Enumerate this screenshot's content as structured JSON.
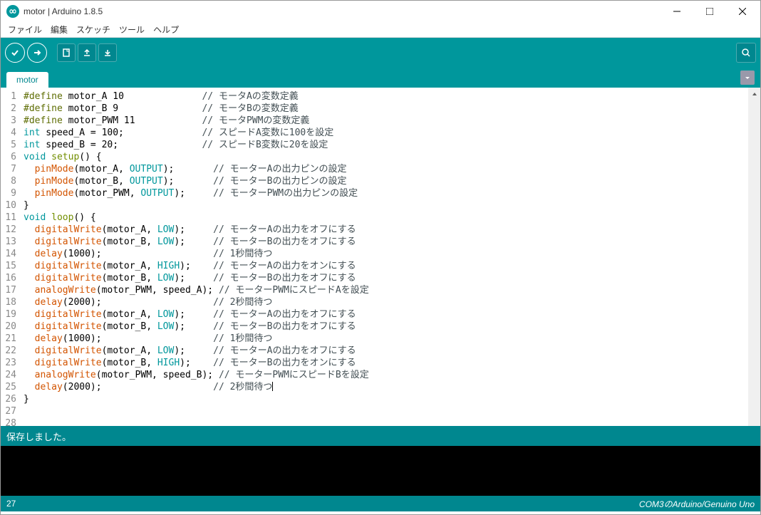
{
  "window": {
    "title": "motor | Arduino 1.8.5"
  },
  "menu": {
    "file": "ファイル",
    "edit": "編集",
    "sketch": "スケッチ",
    "tools": "ツール",
    "help": "ヘルプ"
  },
  "tabs": {
    "current": "motor"
  },
  "status": {
    "message": "保存しました。"
  },
  "footer": {
    "line": "27",
    "board": "COM3のArduino/Genuino Uno"
  },
  "code_lines": [
    {
      "n": 1,
      "t": [
        {
          "c": "def",
          "s": "#define"
        },
        {
          "c": "",
          "s": " motor_A 10              "
        },
        {
          "c": "cm",
          "s": "// モータAの変数定義"
        }
      ]
    },
    {
      "n": 2,
      "t": [
        {
          "c": "def",
          "s": "#define"
        },
        {
          "c": "",
          "s": " motor_B 9               "
        },
        {
          "c": "cm",
          "s": "// モータBの変数定義"
        }
      ]
    },
    {
      "n": 3,
      "t": [
        {
          "c": "def",
          "s": "#define"
        },
        {
          "c": "",
          "s": " motor_PWM 11            "
        },
        {
          "c": "cm",
          "s": "// モータPWMの変数定義"
        }
      ]
    },
    {
      "n": 4,
      "t": [
        {
          "c": "kw",
          "s": "int"
        },
        {
          "c": "",
          "s": " speed_A = 100;              "
        },
        {
          "c": "cm",
          "s": "// スピードA変数に100を設定"
        }
      ]
    },
    {
      "n": 5,
      "t": [
        {
          "c": "kw",
          "s": "int"
        },
        {
          "c": "",
          "s": " speed_B = 20;               "
        },
        {
          "c": "cm",
          "s": "// スピードB変数に20を設定"
        }
      ]
    },
    {
      "n": 6,
      "t": [
        {
          "c": "",
          "s": ""
        }
      ]
    },
    {
      "n": 7,
      "t": [
        {
          "c": "kw",
          "s": "void"
        },
        {
          "c": "",
          "s": " "
        },
        {
          "c": "kw2",
          "s": "setup"
        },
        {
          "c": "",
          "s": "() {"
        }
      ]
    },
    {
      "n": 8,
      "t": [
        {
          "c": "",
          "s": "  "
        },
        {
          "c": "fn",
          "s": "pinMode"
        },
        {
          "c": "",
          "s": "(motor_A, "
        },
        {
          "c": "sv",
          "s": "OUTPUT"
        },
        {
          "c": "",
          "s": ");       "
        },
        {
          "c": "cm",
          "s": "// モーターAの出力ピンの設定"
        }
      ]
    },
    {
      "n": 9,
      "t": [
        {
          "c": "",
          "s": "  "
        },
        {
          "c": "fn",
          "s": "pinMode"
        },
        {
          "c": "",
          "s": "(motor_B, "
        },
        {
          "c": "sv",
          "s": "OUTPUT"
        },
        {
          "c": "",
          "s": ");       "
        },
        {
          "c": "cm",
          "s": "// モーターBの出力ピンの設定"
        }
      ]
    },
    {
      "n": 10,
      "t": [
        {
          "c": "",
          "s": "  "
        },
        {
          "c": "fn",
          "s": "pinMode"
        },
        {
          "c": "",
          "s": "(motor_PWM, "
        },
        {
          "c": "sv",
          "s": "OUTPUT"
        },
        {
          "c": "",
          "s": ");     "
        },
        {
          "c": "cm",
          "s": "// モーターPWMの出力ピンの設定"
        }
      ]
    },
    {
      "n": 11,
      "t": [
        {
          "c": "",
          "s": "}"
        }
      ]
    },
    {
      "n": 12,
      "t": [
        {
          "c": "",
          "s": ""
        }
      ]
    },
    {
      "n": 13,
      "t": [
        {
          "c": "kw",
          "s": "void"
        },
        {
          "c": "",
          "s": " "
        },
        {
          "c": "kw2",
          "s": "loop"
        },
        {
          "c": "",
          "s": "() {"
        }
      ]
    },
    {
      "n": 14,
      "t": [
        {
          "c": "",
          "s": "  "
        },
        {
          "c": "fn",
          "s": "digitalWrite"
        },
        {
          "c": "",
          "s": "(motor_A, "
        },
        {
          "c": "sv",
          "s": "LOW"
        },
        {
          "c": "",
          "s": ");     "
        },
        {
          "c": "cm",
          "s": "// モーターAの出力をオフにする"
        }
      ]
    },
    {
      "n": 15,
      "t": [
        {
          "c": "",
          "s": "  "
        },
        {
          "c": "fn",
          "s": "digitalWrite"
        },
        {
          "c": "",
          "s": "(motor_B, "
        },
        {
          "c": "sv",
          "s": "LOW"
        },
        {
          "c": "",
          "s": ");     "
        },
        {
          "c": "cm",
          "s": "// モーターBの出力をオフにする"
        }
      ]
    },
    {
      "n": 16,
      "t": [
        {
          "c": "",
          "s": "  "
        },
        {
          "c": "fn",
          "s": "delay"
        },
        {
          "c": "",
          "s": "(1000);                    "
        },
        {
          "c": "cm",
          "s": "// 1秒間待つ"
        }
      ]
    },
    {
      "n": 17,
      "t": [
        {
          "c": "",
          "s": "  "
        },
        {
          "c": "fn",
          "s": "digitalWrite"
        },
        {
          "c": "",
          "s": "(motor_A, "
        },
        {
          "c": "sv",
          "s": "HIGH"
        },
        {
          "c": "",
          "s": ");    "
        },
        {
          "c": "cm",
          "s": "// モーターAの出力をオンにする"
        }
      ]
    },
    {
      "n": 18,
      "t": [
        {
          "c": "",
          "s": "  "
        },
        {
          "c": "fn",
          "s": "digitalWrite"
        },
        {
          "c": "",
          "s": "(motor_B, "
        },
        {
          "c": "sv",
          "s": "LOW"
        },
        {
          "c": "",
          "s": ");     "
        },
        {
          "c": "cm",
          "s": "// モーターBの出力をオフにする"
        }
      ]
    },
    {
      "n": 19,
      "t": [
        {
          "c": "",
          "s": "  "
        },
        {
          "c": "fn",
          "s": "analogWrite"
        },
        {
          "c": "",
          "s": "(motor_PWM, speed_A); "
        },
        {
          "c": "cm",
          "s": "// モーターPWMにスピードAを設定"
        }
      ]
    },
    {
      "n": 20,
      "t": [
        {
          "c": "",
          "s": "  "
        },
        {
          "c": "fn",
          "s": "delay"
        },
        {
          "c": "",
          "s": "(2000);                    "
        },
        {
          "c": "cm",
          "s": "// 2秒間待つ"
        }
      ]
    },
    {
      "n": 21,
      "t": [
        {
          "c": "",
          "s": "  "
        },
        {
          "c": "fn",
          "s": "digitalWrite"
        },
        {
          "c": "",
          "s": "(motor_A, "
        },
        {
          "c": "sv",
          "s": "LOW"
        },
        {
          "c": "",
          "s": ");     "
        },
        {
          "c": "cm",
          "s": "// モーターAの出力をオフにする"
        }
      ]
    },
    {
      "n": 22,
      "t": [
        {
          "c": "",
          "s": "  "
        },
        {
          "c": "fn",
          "s": "digitalWrite"
        },
        {
          "c": "",
          "s": "(motor_B, "
        },
        {
          "c": "sv",
          "s": "LOW"
        },
        {
          "c": "",
          "s": ");     "
        },
        {
          "c": "cm",
          "s": "// モーターBの出力をオフにする"
        }
      ]
    },
    {
      "n": 23,
      "t": [
        {
          "c": "",
          "s": "  "
        },
        {
          "c": "fn",
          "s": "delay"
        },
        {
          "c": "",
          "s": "(1000);                    "
        },
        {
          "c": "cm",
          "s": "// 1秒間待つ"
        }
      ]
    },
    {
      "n": 24,
      "t": [
        {
          "c": "",
          "s": "  "
        },
        {
          "c": "fn",
          "s": "digitalWrite"
        },
        {
          "c": "",
          "s": "(motor_A, "
        },
        {
          "c": "sv",
          "s": "LOW"
        },
        {
          "c": "",
          "s": ");     "
        },
        {
          "c": "cm",
          "s": "// モーターAの出力をオフにする"
        }
      ]
    },
    {
      "n": 25,
      "t": [
        {
          "c": "",
          "s": "  "
        },
        {
          "c": "fn",
          "s": "digitalWrite"
        },
        {
          "c": "",
          "s": "(motor_B, "
        },
        {
          "c": "sv",
          "s": "HIGH"
        },
        {
          "c": "",
          "s": ");    "
        },
        {
          "c": "cm",
          "s": "// モーターBの出力をオンにする"
        }
      ]
    },
    {
      "n": 26,
      "t": [
        {
          "c": "",
          "s": "  "
        },
        {
          "c": "fn",
          "s": "analogWrite"
        },
        {
          "c": "",
          "s": "(motor_PWM, speed_B); "
        },
        {
          "c": "cm",
          "s": "// モーターPWMにスピードBを設定"
        }
      ]
    },
    {
      "n": 27,
      "t": [
        {
          "c": "",
          "s": "  "
        },
        {
          "c": "fn",
          "s": "delay"
        },
        {
          "c": "",
          "s": "(2000);                    "
        },
        {
          "c": "cm",
          "s": "// 2秒間待つ"
        }
      ],
      "cursor": true
    },
    {
      "n": 28,
      "t": [
        {
          "c": "",
          "s": "}"
        }
      ]
    }
  ]
}
